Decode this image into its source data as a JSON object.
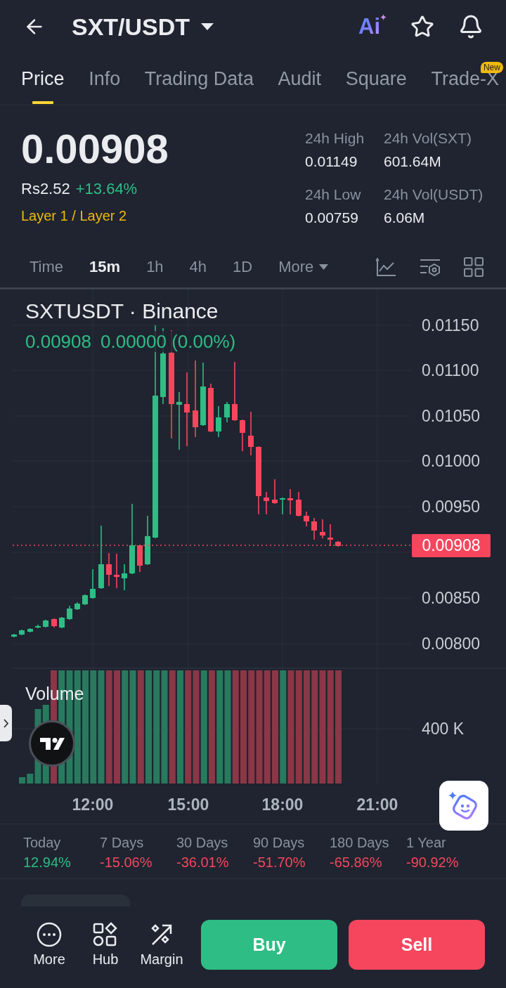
{
  "header": {
    "pair": "SXT/USDT",
    "ai_label": "Ai"
  },
  "tabs": [
    {
      "label": "Price",
      "selected": true
    },
    {
      "label": "Info",
      "selected": false
    },
    {
      "label": "Trading Data",
      "selected": false
    },
    {
      "label": "Audit",
      "selected": false
    },
    {
      "label": "Square",
      "selected": false
    },
    {
      "label": "Trade-X",
      "selected": false,
      "badge": "New"
    }
  ],
  "price": {
    "last": "0.00908",
    "fiat": "Rs2.52",
    "change": "+13.64%",
    "color": "#2ebd85",
    "category": "Layer 1 / Layer 2"
  },
  "stats": [
    {
      "label": "24h High",
      "value": "0.01149"
    },
    {
      "label": "24h Vol(SXT)",
      "value": "601.64M"
    },
    {
      "label": "24h Low",
      "value": "0.00759"
    },
    {
      "label": "24h Vol(USDT)",
      "value": "6.06M"
    }
  ],
  "intervals": [
    {
      "label": "Time",
      "kind": "option",
      "selected": false
    },
    {
      "label": "15m",
      "kind": "option",
      "selected": true
    },
    {
      "label": "1h",
      "kind": "option",
      "selected": false
    },
    {
      "label": "4h",
      "kind": "option",
      "selected": false
    },
    {
      "label": "1D",
      "kind": "option",
      "selected": false
    },
    {
      "label": "More",
      "kind": "menu",
      "selected": false
    }
  ],
  "chart": {
    "title": "SXTUSDT · Binance",
    "legend_values": [
      "0.00908",
      "0.00000 (0.00%)"
    ],
    "price_axis": [
      "0.01150",
      "0.01100",
      "0.01050",
      "0.01000",
      "0.00950",
      "0.00850",
      "0.00800"
    ],
    "last_price_tag": "0.00908",
    "volume_title": "Volume",
    "volume_axis": [
      "400 K"
    ],
    "time_axis": [
      "12:00",
      "15:00",
      "18:00",
      "21:00"
    ]
  },
  "performance": [
    {
      "period": "Today",
      "change": "12.94%",
      "color": "#2ebd85"
    },
    {
      "period": "7 Days",
      "change": "-15.06%",
      "color": "#f6465d"
    },
    {
      "period": "30 Days",
      "change": "-36.01%",
      "color": "#f6465d"
    },
    {
      "period": "90 Days",
      "change": "-51.70%",
      "color": "#f6465d"
    },
    {
      "period": "180 Days",
      "change": "-65.86%",
      "color": "#f6465d"
    },
    {
      "period": "1 Year",
      "change": "-90.92%",
      "color": "#f6465d"
    }
  ],
  "actions": [
    {
      "label": "More"
    },
    {
      "label": "Hub"
    },
    {
      "label": "Margin"
    }
  ],
  "trade_buttons": [
    {
      "label": "Buy",
      "kind": "buy"
    },
    {
      "label": "Sell",
      "kind": "sell"
    }
  ]
}
